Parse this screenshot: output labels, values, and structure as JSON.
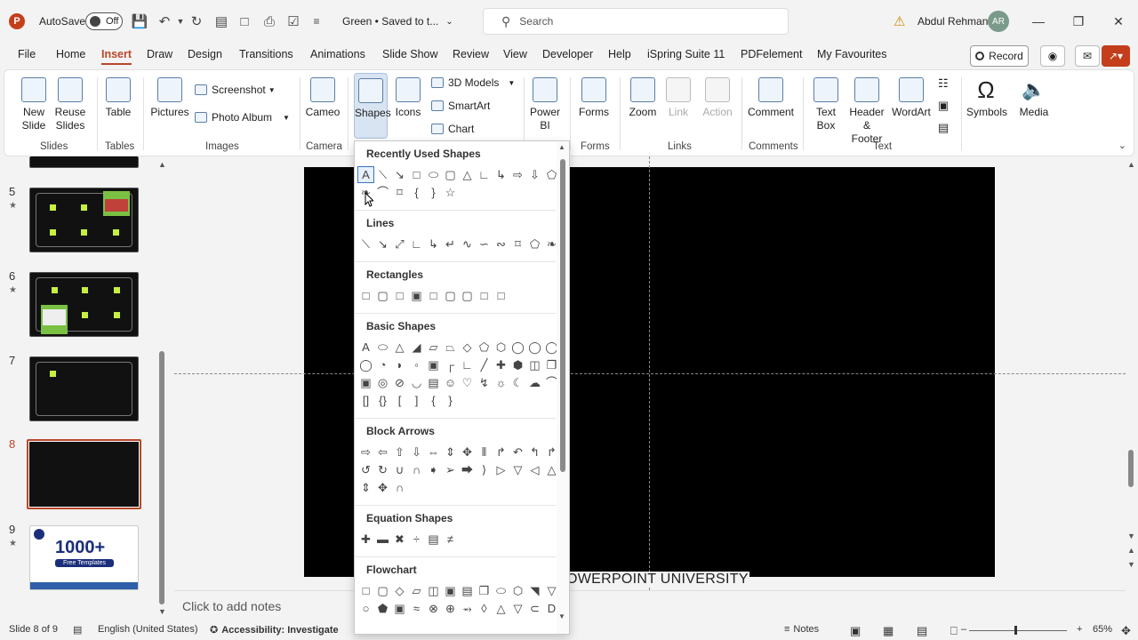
{
  "titlebar": {
    "app_icon": "P",
    "autosave_label": "AutoSave",
    "autosave_state": "Off",
    "doc_title": "Green • Saved to t...",
    "search_placeholder": "Search",
    "user_name": "Abdul Rehman",
    "user_initials": "AR"
  },
  "menu": {
    "tabs": [
      "File",
      "Home",
      "Insert",
      "Draw",
      "Design",
      "Transitions",
      "Animations",
      "Slide Show",
      "Review",
      "View",
      "Developer",
      "Help",
      "iSpring Suite 11",
      "PDFelement",
      "My Favourites"
    ],
    "active": "Insert",
    "record_label": "Record"
  },
  "ribbon": {
    "new_slide": "New Slide",
    "reuse_slides": "Reuse Slides",
    "table": "Table",
    "pictures": "Pictures",
    "screenshot": "Screenshot",
    "photo_album": "Photo Album",
    "cameo": "Cameo",
    "shapes": "Shapes",
    "icons": "Icons",
    "models_3d": "3D Models",
    "smartart": "SmartArt",
    "chart": "Chart",
    "power_bi": "Power BI",
    "forms": "Forms",
    "zoom": "Zoom",
    "link": "Link",
    "action": "Action",
    "comment": "Comment",
    "text_box": "Text Box",
    "header_footer": "Header & Footer",
    "wordart": "WordArt",
    "symbols": "Symbols",
    "media": "Media",
    "groups": {
      "slides": "Slides",
      "tables": "Tables",
      "images": "Images",
      "camera": "Camera",
      "forms": "Forms",
      "links": "Links",
      "comments": "Comments",
      "text": "Text"
    }
  },
  "thumbnails": [
    {
      "number": "5",
      "starred": true
    },
    {
      "number": "6",
      "starred": true
    },
    {
      "number": "7",
      "starred": false
    },
    {
      "number": "8",
      "starred": false,
      "selected": true
    },
    {
      "number": "9",
      "starred": true,
      "big_text": "1000+",
      "bar_text": "Free Templates"
    }
  ],
  "shapes_menu": {
    "categories": [
      "Recently Used Shapes",
      "Lines",
      "Rectangles",
      "Basic Shapes",
      "Block Arrows",
      "Equation Shapes",
      "Flowchart"
    ]
  },
  "slide": {
    "footer_text": "POWERPOINT UNIVERSITY"
  },
  "notes": {
    "placeholder": "Click to add notes"
  },
  "status": {
    "slide_info": "Slide 8 of 9",
    "language": "English (United States)",
    "accessibility": "Accessibility: Investigate",
    "notes_label": "Notes",
    "zoom_level": "65%"
  }
}
